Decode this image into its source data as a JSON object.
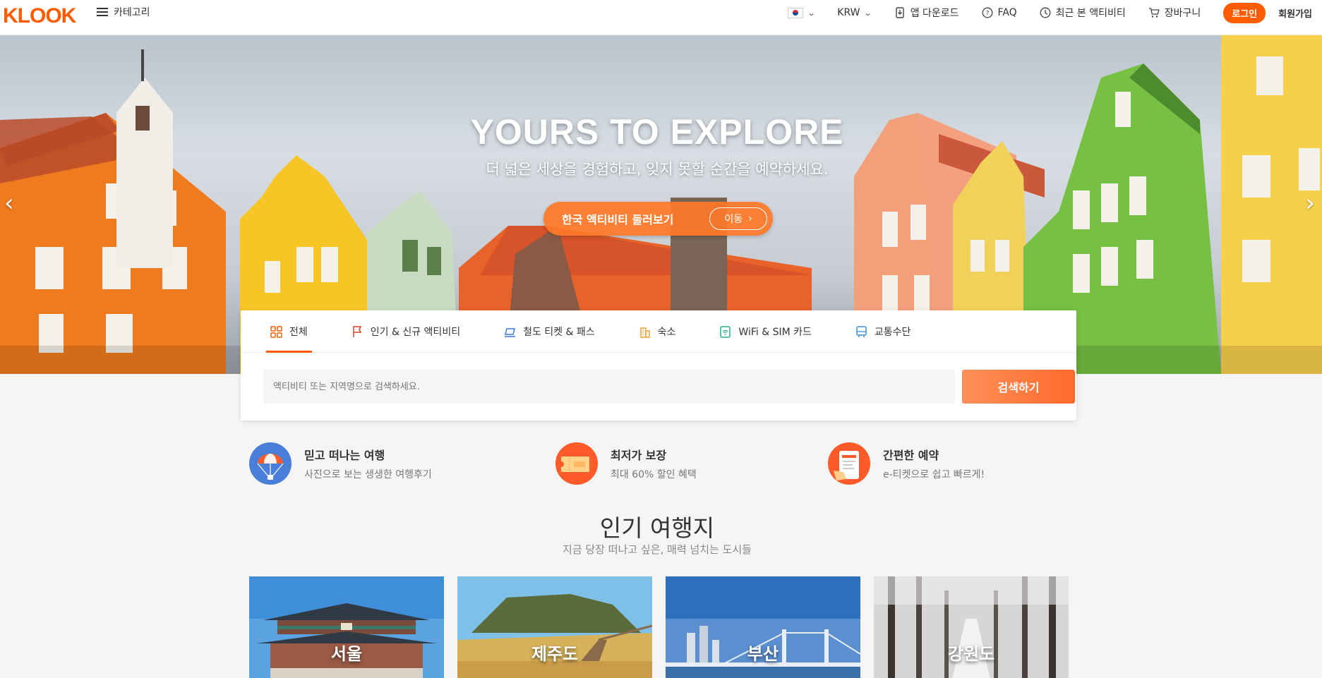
{
  "header": {
    "logo": "KLOOK",
    "category_label": "카테고리",
    "currency": "KRW",
    "app_download": "앱 다운로드",
    "faq": "FAQ",
    "recent": "최근 본 액티비티",
    "cart": "장바구니",
    "login": "로그인",
    "signup": "회원가입",
    "language_flag": "korea-flag-icon"
  },
  "hero": {
    "title": "YOURS TO EXPLORE",
    "subtitle": "더 넓은 세상을 경험하고, 잊지 못할 순간을 예약하세요.",
    "cta_label": "한국 액티비티 둘러보기",
    "cta_go": "이동",
    "prev_icon": "chevron-left-icon",
    "next_icon": "chevron-right-icon"
  },
  "search": {
    "tabs": [
      {
        "label": "전체",
        "icon": "grid-icon",
        "active": true
      },
      {
        "label": "인기 & 신규 액티비티",
        "icon": "flag-icon",
        "active": false
      },
      {
        "label": "철도 티켓 & 패스",
        "icon": "train-ticket-icon",
        "active": false
      },
      {
        "label": "숙소",
        "icon": "building-icon",
        "active": false
      },
      {
        "label": "WiFi & SIM 카드",
        "icon": "wifi-sim-icon",
        "active": false
      },
      {
        "label": "교통수단",
        "icon": "bus-icon",
        "active": false
      }
    ],
    "placeholder": "액티비티 또는 지역명으로 검색하세요.",
    "button": "검색하기"
  },
  "features": [
    {
      "title": "믿고 떠나는 여행",
      "desc": "사진으로 보는 생생한 여행후기",
      "icon": "parachute-icon"
    },
    {
      "title": "최저가 보장",
      "desc": "최대 60% 할인 혜택",
      "icon": "ticket-icon"
    },
    {
      "title": "간편한 예약",
      "desc": "e-티켓으로 쉽고 빠르게!",
      "icon": "phone-ticket-icon"
    }
  ],
  "popular": {
    "title": "인기 여행지",
    "subtitle": "지금 당장 떠나고 싶은, 매력 넘치는 도시들",
    "destinations": [
      "서울",
      "제주도",
      "부산",
      "강원도"
    ]
  },
  "colors": {
    "brand": "#ff5b00",
    "cta": "#ff6a2c"
  }
}
